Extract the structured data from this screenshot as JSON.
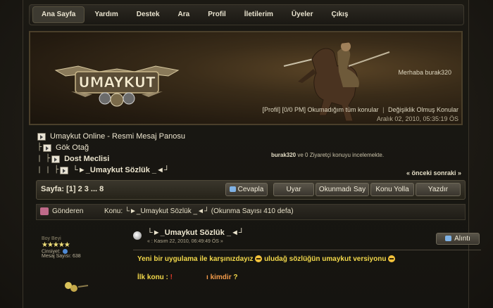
{
  "nav": {
    "items": [
      {
        "label": "Ana Sayfa",
        "active": true
      },
      {
        "label": "Yardım"
      },
      {
        "label": "Destek"
      },
      {
        "label": "Ara"
      },
      {
        "label": "Profil"
      },
      {
        "label": "İletilerim"
      },
      {
        "label": "Üyeler"
      },
      {
        "label": "Çıkış"
      }
    ]
  },
  "header": {
    "logo_text": "UMAYKUT",
    "welcome": "Merhaba burak320",
    "profile_link": "[Profil]",
    "pm_link": "[0/0 PM]",
    "unread_link": "Okumadığım tüm konular",
    "changed_link": "Değişiklik Olmuş Konular",
    "date": "Aralık 02, 2010, 05:35:19 ÖS"
  },
  "breadcrumb": {
    "items": [
      {
        "tree": "",
        "label": "Umaykut Online - Resmi Mesaj Panosu",
        "bold": false
      },
      {
        "tree": "├",
        "label": "Gök Otağ",
        "bold": false
      },
      {
        "tree": "| ├",
        "label": "Dost Meclisi",
        "bold": true
      },
      {
        "tree": "| | ├",
        "label": "└►_Umaykut Sözlük _◄┘",
        "bold": true
      }
    ]
  },
  "viewers": {
    "user": "burak320",
    "text": " ve 0 Ziyaretçi konuyu incelemekte."
  },
  "prevnext": "« önceki sonraki »",
  "pagination": {
    "label": "Sayfa: [1] 2 3 ... 8"
  },
  "buttons": {
    "reply": "Cevapla",
    "notify": "Uyar",
    "unread": "Okunmadı Say",
    "send_topic": "Konu Yolla",
    "print": "Yazdır"
  },
  "topic_header": {
    "author_col": "Gönderen",
    "topic": "Konu: └►_Umaykut Sözlük _◄┘  (Okunma Sayısı 410 defa)"
  },
  "post": {
    "author_rank": "Boy Beyi",
    "stars": "★★★★★",
    "gender_label": "Cinsiyet:",
    "posts_label": "Mesaj Sayısı: 638",
    "title": "└►_Umaykut Sözlük _◄┘",
    "date": "« : Kasım 22, 2010, 06:49:49 ÖS »",
    "quote_label": "Alıntı",
    "body_line1": "Yeni bir uygulama ile karşınızdayız",
    "body_line1b": "uludağ sözlüğün umaykut versiyonu",
    "body_line2_a": "İlk konu : ",
    "body_line2_b": "!",
    "body_line2_c": "ı kimdir",
    "body_line2_d": " ?"
  }
}
